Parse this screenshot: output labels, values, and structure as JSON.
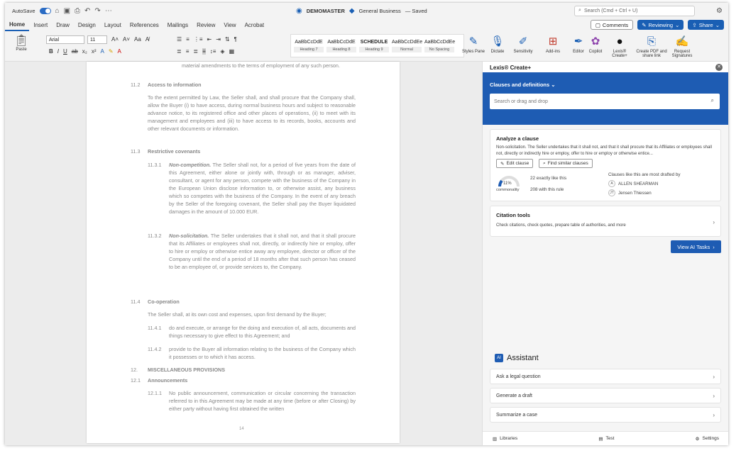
{
  "titlebar": {
    "autosave": "AutoSave",
    "doc_name": "DEMOMASTER",
    "sensitivity": "General Business",
    "saved": "— Saved",
    "search_placeholder": "Search (Cmd + Ctrl + U)"
  },
  "tabs": [
    "Home",
    "Insert",
    "Draw",
    "Design",
    "Layout",
    "References",
    "Mailings",
    "Review",
    "View",
    "Acrobat"
  ],
  "tab_actions": {
    "comments": "Comments",
    "reviewing": "Reviewing",
    "share": "Share"
  },
  "ribbon": {
    "paste": "Paste",
    "font_name": "Arial",
    "font_size": "11",
    "styles": [
      {
        "preview": "AaBbCcDdE",
        "name": "Heading 7"
      },
      {
        "preview": "AaBbCcDdE",
        "name": "Heading 8"
      },
      {
        "preview": "SCHEDULE",
        "name": "Heading 9"
      },
      {
        "preview": "AaBbCcDdEe",
        "name": "Normal"
      },
      {
        "preview": "AaBbCcDdEe",
        "name": "No Spacing"
      }
    ],
    "buttons": {
      "styles_pane": "Styles Pane",
      "dictate": "Dictate",
      "sensitivity": "Sensitivity",
      "add_ins": "Add-ins",
      "editor": "Editor",
      "copilot": "Copilot",
      "lexis_create": "Lexis® Create+",
      "create_pdf": "Create PDF and share link",
      "request_sig": "Request Signatures"
    }
  },
  "document": {
    "intro_para": "material amendments to the terms of employment of any such person.",
    "s1_num": "11.2",
    "s1_head": "Access to information",
    "s1_para": "To the extent permitted by Law, the Seller shall, and shall procure that the Company shall, allow the Buyer (i) to have access, during normal business hours and subject to reasonable advance notice, to its registered office and other places of operations, (ii) to meet with its management and employees and (iii) to have access to its records, books, accounts and other relevant documents or information.",
    "s2_num": "11.3",
    "s2_head": "Restrictive covenants",
    "c1_num": "11.3.1",
    "c1_title": "Non-competition.",
    "c1_para": "The Seller shall not, for a period of five years from the date of this Agreement, either alone or jointly with, through or as manager, adviser, consultant, or agent for any person, compete with the business of the Company in the European Union disclose information to, or otherwise assist, any business which so competes with the business of the Company. In the event of any breach by the Seller of the foregoing covenant, the Seller shall pay the Buyer liquidated damages in the amount of 10.000 EUR.",
    "c2_num": "11.3.2",
    "c2_title": "Non-solicitation.",
    "c2_para": "The Seller undertakes that it shall not, and that it shall procure that its Affiliates or employees shall not, directly, or indirectly hire or employ, offer to hire or employ or otherwise entice away any employee, director or officer of the Company until the end of a period of 18 months after that such person has ceased to be an employee of, or provide services to, the Company.",
    "s3_num": "11.4",
    "s3_head": "Co-operation",
    "s3_para": "The Seller shall, at its own cost and expenses, upon first demand by the Buyer;",
    "c3_num": "11.4.1",
    "c3_para": "do and execute, or arrange for the doing and execution of, all acts, documents and things necessary to give effect to this Agreement; and",
    "c4_num": "11.4.2",
    "c4_para": "provide to the Buyer all information relating to the business of the Company which it possesses or to which it has access.",
    "s4_num": "12.",
    "s4_head": "MISCELLANEOUS PROVISIONS",
    "s5_num": "12.1",
    "s5_head": "Announcements",
    "c5_num": "12.1.1",
    "c5_para": "No public announcement, communication or circular concerning the transaction referred to in this Agreement may be made at any time (before or after Closing) by either party without having first obtained the written",
    "page_number": "14"
  },
  "panel": {
    "title": "Lexis® Create+",
    "section_label": "Clauses and definitions",
    "search_placeholder": "Search or drag and drop",
    "analyze": {
      "title": "Analyze a clause",
      "text": "Non-solicitation. The Seller undertakes that it shall not, and that it shall procure that its Affiliates or employees shall not, directly or indirectly hire or employ, offer to hire or employ or otherwise entice...",
      "edit_btn": "Edit clause",
      "find_btn": "Find similar clauses",
      "gauge_value": "11%",
      "gauge_label": "commonality",
      "exactly": "22 exactly like this",
      "with_this": "208 with this rule",
      "drafted_by": "Clauses like this are most drafted by",
      "authors": [
        {
          "initials": "A",
          "name": "ALLEN SHEARMAN"
        },
        {
          "initials": "JT",
          "name": "Jensen Thiessen"
        }
      ]
    },
    "citation": {
      "title": "Citation tools",
      "text": "Check citations, check quotes, prepare table of authorities, and more"
    },
    "view_ai": "View AI Tasks",
    "assistant": {
      "badge": "AI",
      "title": "Assistant",
      "items": [
        "Ask a legal question",
        "Generate a draft",
        "Summarize a case"
      ]
    },
    "footer": {
      "libraries": "Libraries",
      "test": "Test",
      "settings": "Settings"
    }
  },
  "colors": {
    "accent": "#1e5cb3"
  }
}
